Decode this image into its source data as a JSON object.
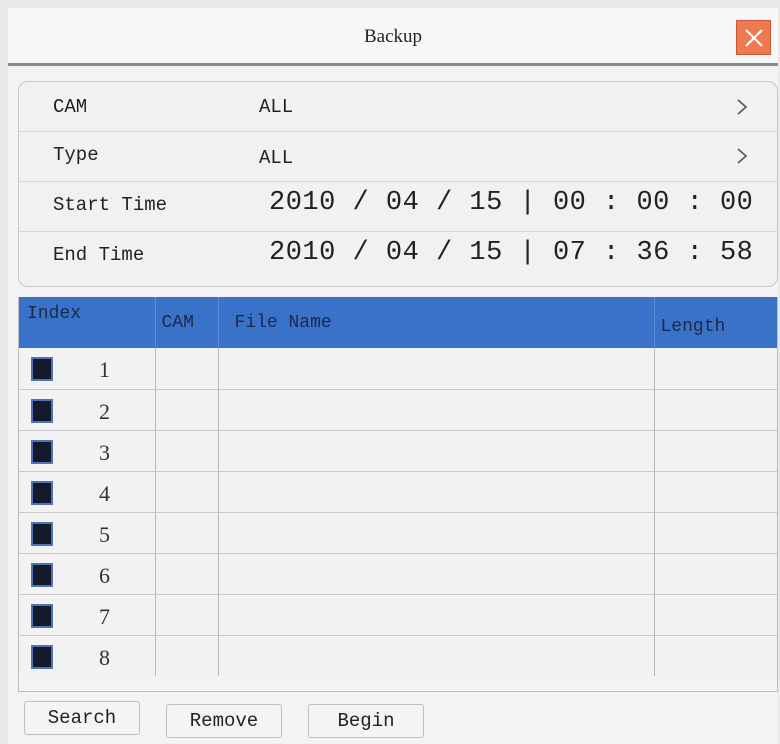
{
  "window": {
    "title": "Backup"
  },
  "params": {
    "cam": {
      "label": "CAM",
      "value": "ALL"
    },
    "type": {
      "label": "Type",
      "value": "ALL"
    },
    "start_time": {
      "label": "Start Time",
      "value": "2010 / 04 / 15 | 00 : 00 : 00"
    },
    "end_time": {
      "label": "End Time",
      "value": "2010 / 04 / 15 | 07 : 36 : 58"
    }
  },
  "table": {
    "headers": {
      "index": "Index",
      "cam": "CAM",
      "file_name": "File Name",
      "length": "Length"
    },
    "rows": [
      {
        "index": "1",
        "cam": "",
        "file_name": "",
        "length": ""
      },
      {
        "index": "2",
        "cam": "",
        "file_name": "",
        "length": ""
      },
      {
        "index": "3",
        "cam": "",
        "file_name": "",
        "length": ""
      },
      {
        "index": "4",
        "cam": "",
        "file_name": "",
        "length": ""
      },
      {
        "index": "5",
        "cam": "",
        "file_name": "",
        "length": ""
      },
      {
        "index": "6",
        "cam": "",
        "file_name": "",
        "length": ""
      },
      {
        "index": "7",
        "cam": "",
        "file_name": "",
        "length": ""
      },
      {
        "index": "8",
        "cam": "",
        "file_name": "",
        "length": ""
      }
    ]
  },
  "buttons": {
    "search": "Search",
    "remove": "Remove",
    "begin": "Begin"
  },
  "colors": {
    "header_blue": "#3a72c9",
    "close_orange": "#ef7a4f",
    "checkbox_fill": "#14192c"
  },
  "icons": {
    "close": "close-icon",
    "chevron": "chevron-right-icon"
  }
}
